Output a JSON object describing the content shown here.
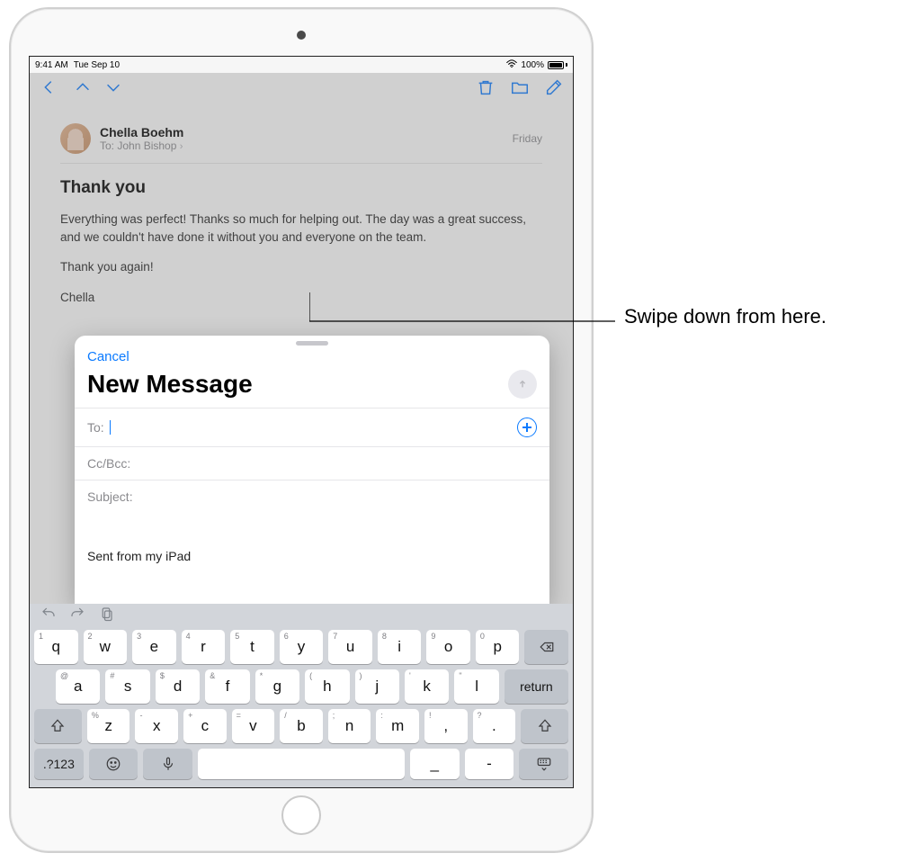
{
  "status": {
    "time": "9:41 AM",
    "date": "Tue Sep 10",
    "battery": "100%"
  },
  "mail": {
    "from": "Chella Boehm",
    "to_label": "To:",
    "to_name": "John Bishop",
    "date": "Friday",
    "subject": "Thank you",
    "body_p1": "Everything was perfect! Thanks so much for helping out. The day was a great success, and we couldn't have done it without you and everyone on the team.",
    "body_p2": "Thank you again!",
    "body_p3": "Chella"
  },
  "compose": {
    "cancel": "Cancel",
    "title": "New Message",
    "to_label": "To:",
    "cc_label": "Cc/Bcc:",
    "subject_label": "Subject:",
    "signature": "Sent from my iPad"
  },
  "keyboard": {
    "row1": [
      {
        "k": "q",
        "a": "1"
      },
      {
        "k": "w",
        "a": "2"
      },
      {
        "k": "e",
        "a": "3"
      },
      {
        "k": "r",
        "a": "4"
      },
      {
        "k": "t",
        "a": "5"
      },
      {
        "k": "y",
        "a": "6"
      },
      {
        "k": "u",
        "a": "7"
      },
      {
        "k": "i",
        "a": "8"
      },
      {
        "k": "o",
        "a": "9"
      },
      {
        "k": "p",
        "a": "0"
      }
    ],
    "row2": [
      {
        "k": "a",
        "a": "@"
      },
      {
        "k": "s",
        "a": "#"
      },
      {
        "k": "d",
        "a": "$"
      },
      {
        "k": "f",
        "a": "&"
      },
      {
        "k": "g",
        "a": "*"
      },
      {
        "k": "h",
        "a": "("
      },
      {
        "k": "j",
        "a": ")"
      },
      {
        "k": "k",
        "a": "'"
      },
      {
        "k": "l",
        "a": "\""
      }
    ],
    "return": "return",
    "row3": [
      {
        "k": "z",
        "a": "%"
      },
      {
        "k": "x",
        "a": "-"
      },
      {
        "k": "c",
        "a": "+"
      },
      {
        "k": "v",
        "a": "="
      },
      {
        "k": "b",
        "a": "/"
      },
      {
        "k": "n",
        "a": ";"
      },
      {
        "k": "m",
        "a": ":"
      },
      {
        "k": ",",
        "a": "!"
      },
      {
        "k": ".",
        "a": "?"
      }
    ],
    "numkey": ".?123",
    "underscore": "_",
    "dash": "-"
  },
  "annotation": {
    "text": "Swipe down from here."
  }
}
